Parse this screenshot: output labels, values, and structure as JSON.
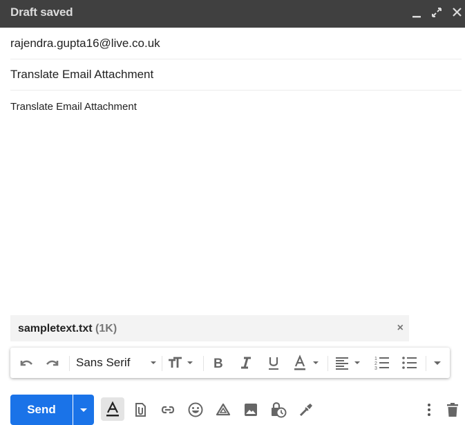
{
  "window": {
    "title": "Draft saved",
    "controls": [
      "minimize-icon",
      "expand-icon",
      "close-icon"
    ]
  },
  "compose": {
    "to": "rajendra.gupta16@live.co.uk",
    "subject": "Translate Email Attachment",
    "body": "Translate Email Attachment"
  },
  "attachment": {
    "name": "sampletext.txt",
    "size": "(1K)",
    "remove_label": "×"
  },
  "format_toolbar": {
    "font": "Sans Serif",
    "items": [
      "undo-icon",
      "redo-icon",
      "font-select",
      "text-size-icon",
      "bold-icon",
      "italic-icon",
      "underline-icon",
      "text-color-icon",
      "align-icon",
      "numbered-list-icon",
      "bulleted-list-icon",
      "more-formatting-icon"
    ]
  },
  "bottom_toolbar": {
    "send_label": "Send",
    "items": [
      "formatting-options-icon",
      "attach-file-icon",
      "insert-link-icon",
      "emoji-icon",
      "drive-icon",
      "insert-photo-icon",
      "confidential-mode-icon",
      "signature-icon",
      "more-options-icon",
      "discard-draft-icon"
    ]
  },
  "colors": {
    "titlebar": "#404040",
    "send": "#1a73e8",
    "icon": "#666666"
  }
}
